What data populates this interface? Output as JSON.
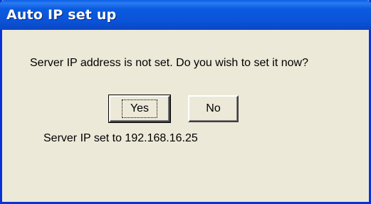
{
  "dialog": {
    "title": "Auto IP set up",
    "message": "Server IP address is not set. Do you wish to set it now?",
    "buttons": {
      "yes_label": "Yes",
      "no_label": "No"
    },
    "status": "Server IP set to 192.168.16.25"
  },
  "colors": {
    "titlebar": "#0b53d8",
    "frame": "#0831d9",
    "background": "#ece9d8"
  }
}
